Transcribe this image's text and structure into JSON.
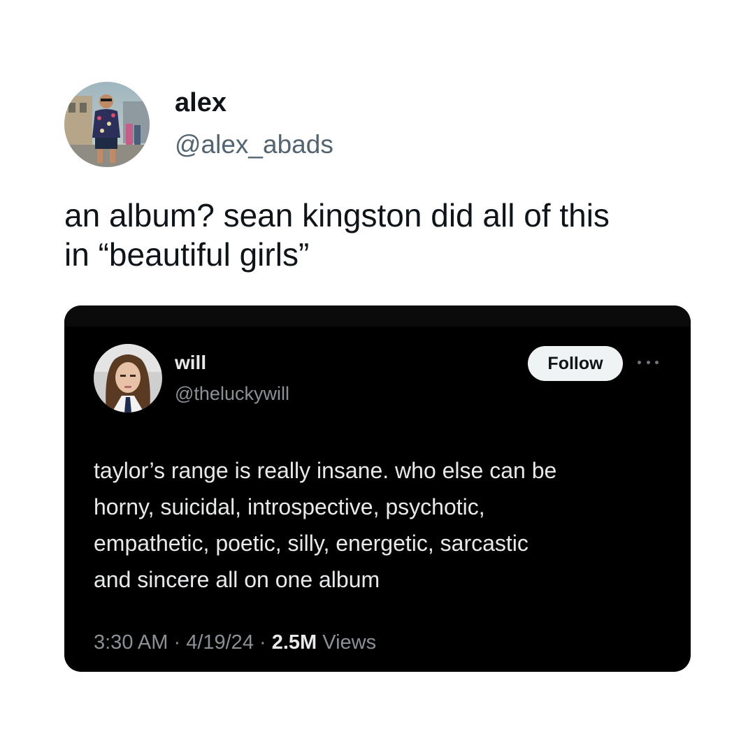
{
  "outer_tweet": {
    "display_name": "alex",
    "handle": "@alex_abads",
    "text_line_1": "an album? sean kingston did all of this",
    "text_line_2": "in “beautiful girls”"
  },
  "quoted_tweet": {
    "display_name": "will",
    "handle": "@theluckywill",
    "follow_label": "Follow",
    "text_line_1": "taylor’s range is really insane. who else can be",
    "text_line_2": "horny, suicidal, introspective, psychotic,",
    "text_line_3": "empathetic, poetic, silly, energetic, sarcastic",
    "text_line_4": "and sincere all on one album",
    "time": "3:30 AM",
    "separator": " · ",
    "date": "4/19/24",
    "views_count": "2.5M",
    "views_label": " Views"
  },
  "icons": {
    "more": "more-horizontal-icon"
  },
  "colors": {
    "outer_background": "#ffffff",
    "outer_text": "#0f1419",
    "outer_handle": "#536471",
    "card_background": "#000000",
    "card_text": "#e7e9ea",
    "card_secondary": "#8b9096",
    "follow_button_bg": "#eff3f4"
  }
}
